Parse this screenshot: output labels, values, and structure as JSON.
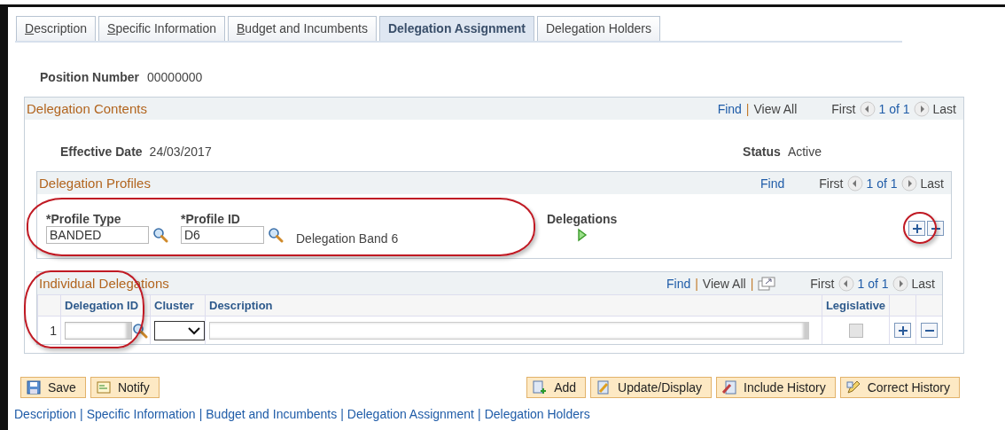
{
  "tabs": [
    {
      "label": "Description",
      "selected": false,
      "accesskey": true
    },
    {
      "label": "Specific Information",
      "selected": false,
      "accesskey": true
    },
    {
      "label": "Budget and Incumbents",
      "selected": false,
      "accesskey": true
    },
    {
      "label": "Delegation Assignment",
      "selected": true,
      "accesskey": false
    },
    {
      "label": "Delegation Holders",
      "selected": false,
      "accesskey": false
    }
  ],
  "position": {
    "label": "Position Number",
    "value": "00000000"
  },
  "contents": {
    "title": "Delegation Contents",
    "nav": {
      "find": "Find",
      "separator": "|",
      "view_all": "View All",
      "first": "First",
      "count": "1 of 1",
      "last": "Last"
    },
    "effective_date": {
      "label": "Effective Date",
      "value": "24/03/2017"
    },
    "status": {
      "label": "Status",
      "value": "Active"
    },
    "profiles": {
      "title": "Delegation Profiles",
      "nav": {
        "find": "Find",
        "first": "First",
        "count": "1 of 1",
        "last": "Last"
      },
      "highlighted": true,
      "fields": [
        {
          "label": "*Profile Type",
          "value": "BANDED"
        },
        {
          "label": "*Profile ID",
          "value": "D6"
        }
      ],
      "description": "Delegation Band 6",
      "delegations_label": "Delegations",
      "add_highlighted": true
    },
    "individual": {
      "title": "Individual Delegations",
      "nav": {
        "find": "Find",
        "separator": "|",
        "view_all": "View All",
        "popup": true,
        "first": "First",
        "count": "1 of 1",
        "last": "Last"
      },
      "columns": [
        "Delegation ID",
        "Cluster",
        "Description",
        "Legislative"
      ],
      "id_highlighted": true,
      "rows": [
        {
          "number": "1",
          "legislative_checked": false
        }
      ]
    }
  },
  "buttons_left": [
    {
      "label": "Save",
      "kind": "save"
    },
    {
      "label": "Notify",
      "kind": "notify"
    }
  ],
  "buttons_right": [
    {
      "label": "Add",
      "kind": "add"
    },
    {
      "label": "Update/Display",
      "kind": "update"
    },
    {
      "label": "Include History",
      "kind": "include"
    },
    {
      "label": "Correct History",
      "kind": "correct"
    }
  ],
  "footer": {
    "separator": "|",
    "links": [
      "Description",
      "Specific Information",
      "Budget and Incumbents",
      "Delegation Assignment",
      "Delegation Holders"
    ]
  }
}
